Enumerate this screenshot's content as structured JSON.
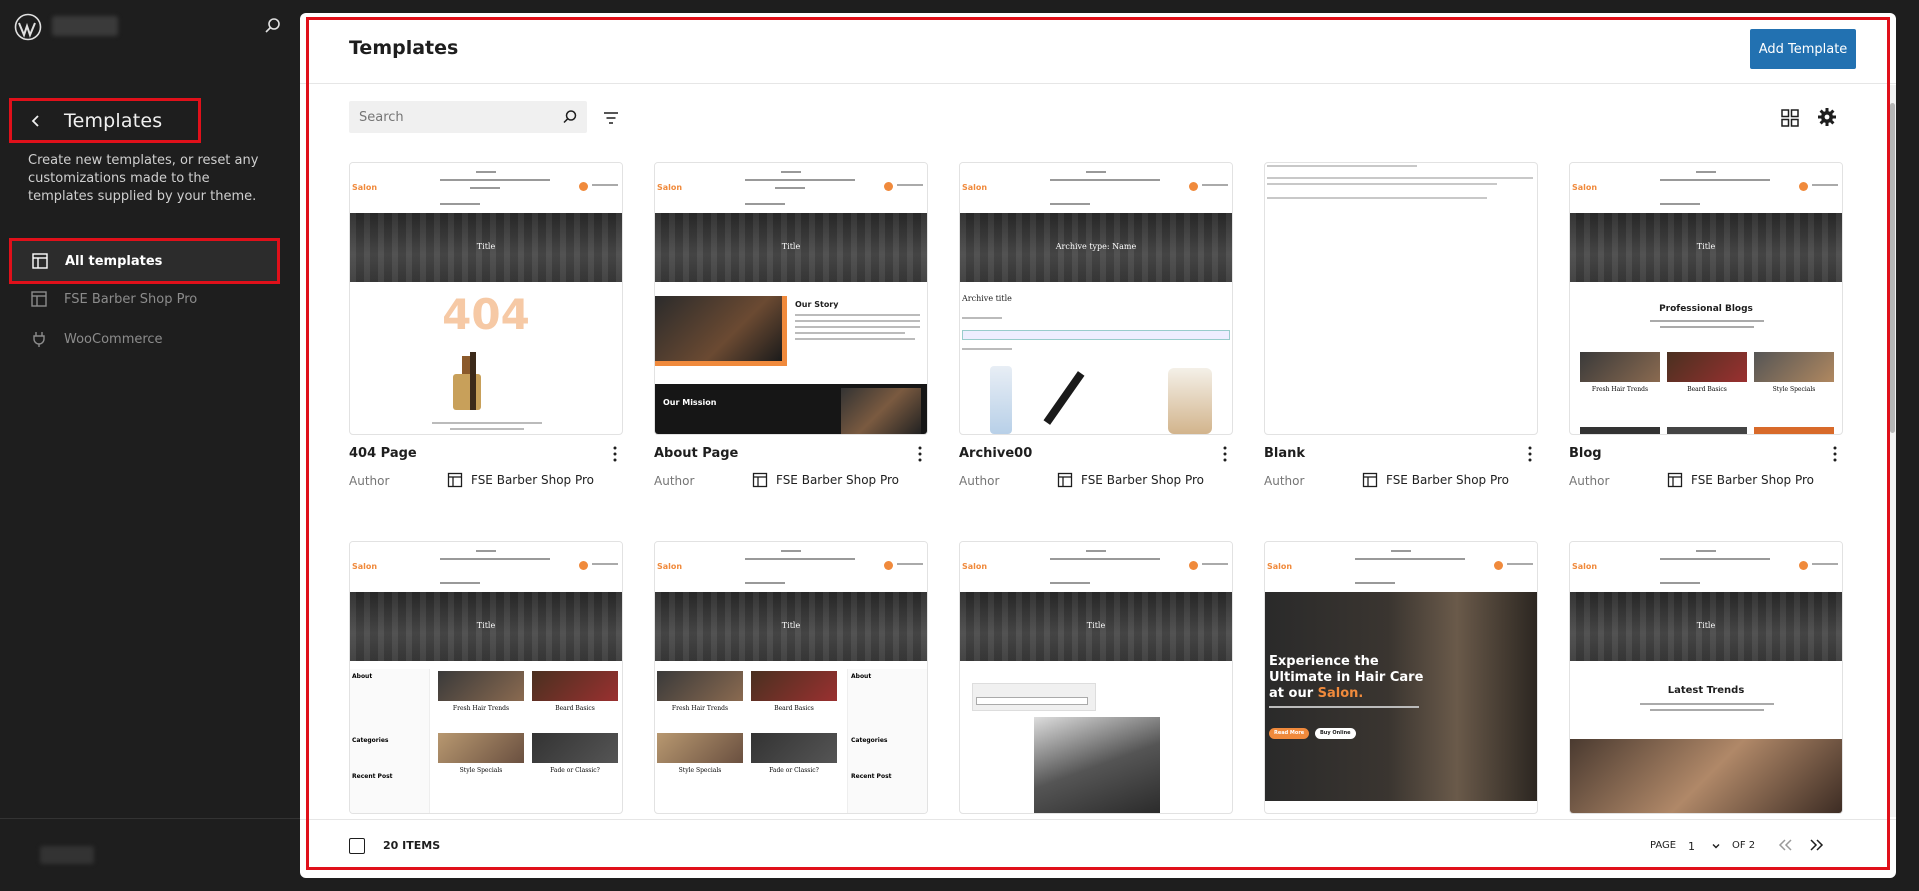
{
  "sidebar": {
    "back_title": "Templates",
    "description": "Create new templates, or reset any customizations made to the templates supplied by your theme.",
    "items": [
      {
        "label": "All templates",
        "icon": "layout-icon",
        "active": true
      },
      {
        "label": "FSE Barber Shop Pro",
        "icon": "layout-icon",
        "active": false
      },
      {
        "label": "WooCommerce",
        "icon": "plug-icon",
        "active": false
      }
    ]
  },
  "header": {
    "title": "Templates",
    "add_button": "Add Template"
  },
  "toolbar": {
    "search_placeholder": "Search"
  },
  "author_label": "Author",
  "templates": [
    {
      "title": "404 Page",
      "author": "FSE Barber Shop Pro",
      "hero": "Title",
      "body": "404"
    },
    {
      "title": "About Page",
      "author": "FSE Barber Shop Pro",
      "hero": "Title",
      "body": "about"
    },
    {
      "title": "Archive00",
      "author": "FSE Barber Shop Pro",
      "hero": "Archive type: Name",
      "body": "archive"
    },
    {
      "title": "Blank",
      "author": "FSE Barber Shop Pro",
      "hero": "",
      "body": "blank"
    },
    {
      "title": "Blog",
      "author": "FSE Barber Shop Pro",
      "hero": "Title",
      "body": "blog"
    },
    {
      "title": "",
      "author": "",
      "hero": "Title",
      "body": "blog-left"
    },
    {
      "title": "",
      "author": "",
      "hero": "Title",
      "body": "blog-right"
    },
    {
      "title": "",
      "author": "",
      "hero": "Title",
      "body": "contact"
    },
    {
      "title": "",
      "author": "",
      "hero": "",
      "body": "front"
    },
    {
      "title": "",
      "author": "",
      "hero": "Title",
      "body": "gallery"
    }
  ],
  "thumb_text": {
    "logo": "Salon",
    "text_404": "404",
    "our_story": "Our Story",
    "our_mission": "Our Mission",
    "archive_title": "Archive title",
    "professional_blogs": "Professional Blogs",
    "fresh_hair_trends": "Fresh Hair Trends",
    "beard_basics": "Beard Basics",
    "style_specials": "Style Specials",
    "fade_or_classic": "Fade or Classic?",
    "about": "About",
    "categories": "Categories",
    "recent_post": "Recent Post",
    "latest_trends": "Latest Trends",
    "hero_line1": "Experience the",
    "hero_line2": "Ultimate in Hair Care",
    "hero_line3": "at our ",
    "hero_salon": "Salon.",
    "read_more": "Read More",
    "buy_online": "Buy Online"
  },
  "footer": {
    "items_count": "20 ITEMS",
    "page_label": "PAGE",
    "page_value": "1",
    "page_of": "OF 2"
  },
  "colors": {
    "accent": "#2271b1",
    "highlight": "#e0101a",
    "brand_orange": "#f08a3c"
  }
}
